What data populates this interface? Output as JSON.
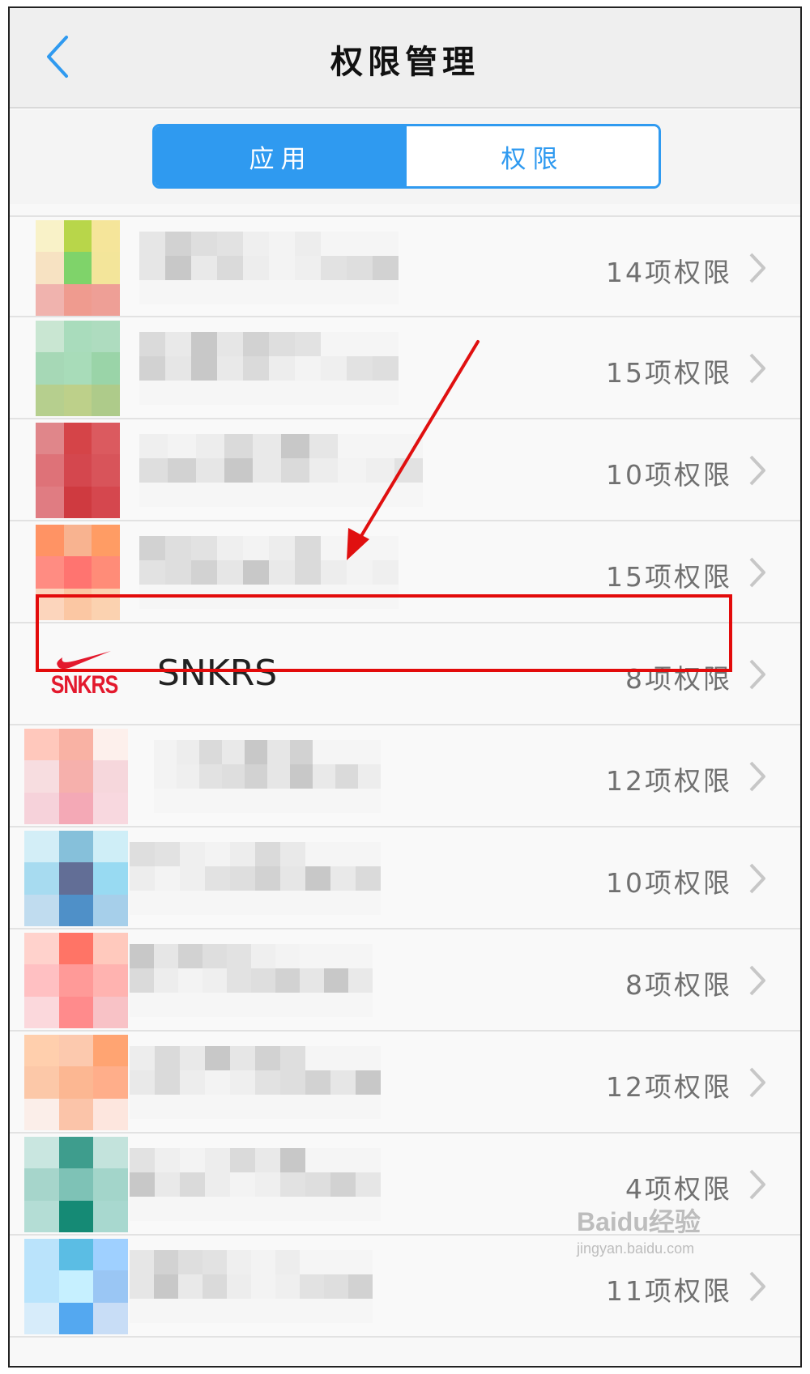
{
  "header": {
    "title": "权限管理"
  },
  "tabs": [
    {
      "label": "应用",
      "active": true
    },
    {
      "label": "权限",
      "active": false
    }
  ],
  "apps": [
    {
      "name": "",
      "permissions": "14项权限",
      "blurred": true
    },
    {
      "name": "",
      "permissions": "15项权限",
      "blurred": true
    },
    {
      "name": "",
      "permissions": "10项权限",
      "blurred": true
    },
    {
      "name": "",
      "permissions": "15项权限",
      "blurred": true
    },
    {
      "name": "SNKRS",
      "permissions": "8项权限",
      "blurred": false,
      "logo_text": "SNKRS"
    },
    {
      "name": "",
      "permissions": "12项权限",
      "blurred": true
    },
    {
      "name": "",
      "permissions": "10项权限",
      "blurred": true
    },
    {
      "name": "",
      "permissions": "8项权限",
      "blurred": true
    },
    {
      "name": "",
      "permissions": "12项权限",
      "blurred": true
    },
    {
      "name": "",
      "permissions": "4项权限",
      "blurred": true
    },
    {
      "name": "",
      "permissions": "11项权限",
      "blurred": true
    }
  ],
  "watermark": {
    "brand": "Baidu经验",
    "url": "jingyan.baidu.com"
  },
  "colors": {
    "accent": "#2f9af0",
    "highlight": "#e30b0b",
    "annotation_arrow": "#e01010"
  }
}
